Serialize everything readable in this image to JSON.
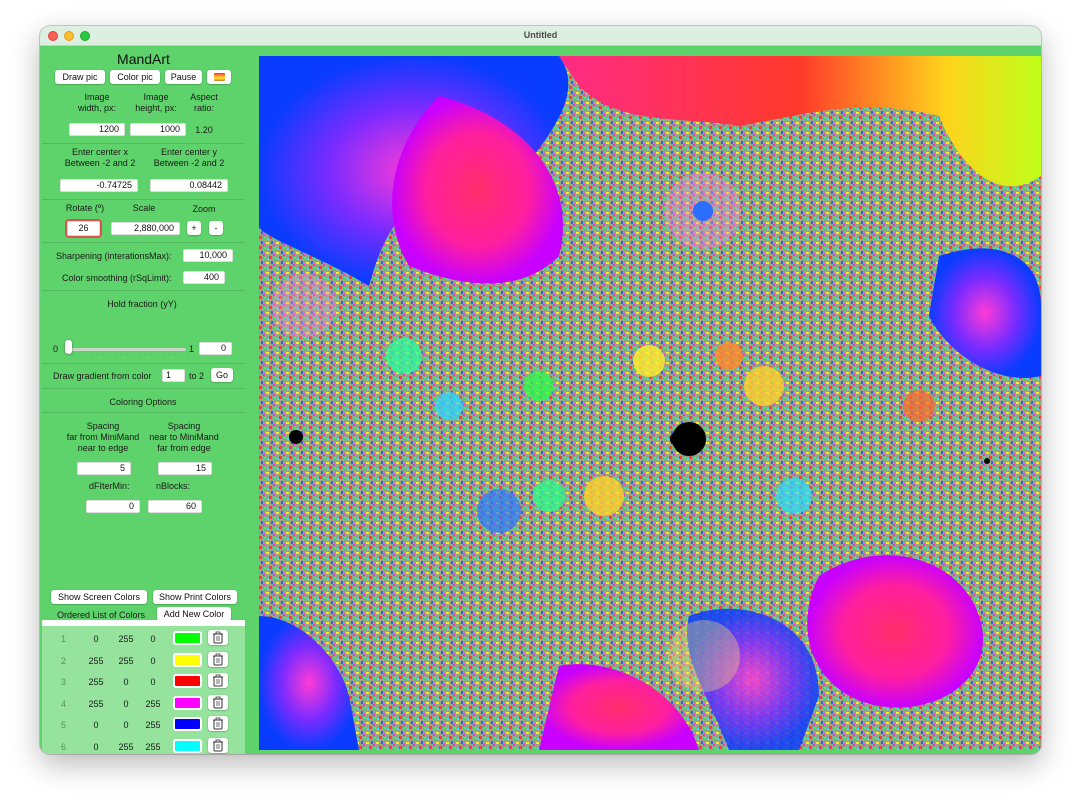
{
  "window": {
    "title": "Untitled"
  },
  "sidebar": {
    "app_name": "MandArt",
    "toolbar": {
      "draw_pic": "Draw pic",
      "color_pic": "Color pic",
      "pause": "Pause",
      "gradient_icon": "gradient-swatch-icon"
    },
    "image_size": {
      "width_label_1": "Image",
      "width_label_2": "width, px:",
      "height_label_1": "Image",
      "height_label_2": "height, px:",
      "aspect_label_1": "Aspect",
      "aspect_label_2": "ratio:",
      "width_value": "1200",
      "height_value": "1000",
      "aspect_value": "1.20"
    },
    "center": {
      "x_label_1": "Enter center x",
      "x_label_2": "Between -2 and 2",
      "y_label_1": "Enter center y",
      "y_label_2": "Between -2 and 2",
      "x_value": "-0.74725",
      "y_value": "0.08442"
    },
    "transform": {
      "rotate_label": "Rotate (º)",
      "scale_label": "Scale",
      "zoom_label": "Zoom",
      "rotate_value": "26",
      "scale_value": "2,880,000",
      "zoom_in": "+",
      "zoom_out": "-"
    },
    "sharpening": {
      "label": "Sharpening (interationsMax):",
      "value": "10,000"
    },
    "smoothing": {
      "label": "Color smoothing (rSqLimit):",
      "value": "400"
    },
    "hold": {
      "label": "Hold fraction (yY)",
      "min": "0",
      "max": "1",
      "value": "0",
      "slider_fraction": 0.0
    },
    "gradient": {
      "label": "Draw gradient from color",
      "from": "1",
      "to_label": "to 2",
      "go": "Go"
    },
    "coloring_options": "Coloring Options",
    "spacing": {
      "far_label_1": "Spacing",
      "far_label_2": "far from MiniMand",
      "far_label_3": "near to edge",
      "near_label_1": "Spacing",
      "near_label_2": "near to MiniMand",
      "near_label_3": "far from edge",
      "far_value": "5",
      "near_value": "15"
    },
    "filters": {
      "dfiter_label": "dFIterMin:",
      "nblocks_label": "nBlocks:",
      "dfiter_value": "0",
      "nblocks_value": "60"
    },
    "buttons": {
      "show_screen_colors": "Show Screen Colors",
      "show_print_colors": "Show Print Colors",
      "ordered_list_label": "Ordered List of Colors",
      "add_new_color": "Add New Color"
    },
    "colors": [
      {
        "n": "1",
        "r": "0",
        "g": "255",
        "b": "0",
        "hex": "#00ff00"
      },
      {
        "n": "2",
        "r": "255",
        "g": "255",
        "b": "0",
        "hex": "#ffff00"
      },
      {
        "n": "3",
        "r": "255",
        "g": "0",
        "b": "0",
        "hex": "#ff0000"
      },
      {
        "n": "4",
        "r": "255",
        "g": "0",
        "b": "255",
        "hex": "#ff00ff"
      },
      {
        "n": "5",
        "r": "0",
        "g": "0",
        "b": "255",
        "hex": "#0000ff"
      },
      {
        "n": "6",
        "r": "0",
        "g": "255",
        "b": "255",
        "hex": "#00ffff"
      }
    ]
  },
  "theme": {
    "panel_green": "#5fd36b",
    "list_green": "#95e39c",
    "highlight_red": "#d9534f"
  }
}
